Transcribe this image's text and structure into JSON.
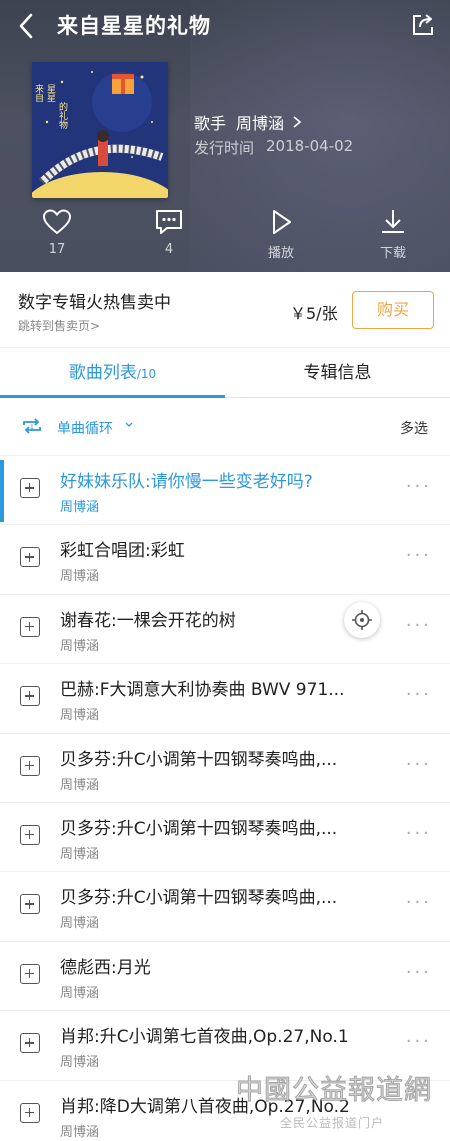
{
  "header": {
    "title": "来自星星的礼物"
  },
  "album": {
    "artist_label": "歌手",
    "artist_name": "周博涵",
    "release_label": "发行时间",
    "release_date": "2018-04-02",
    "cover_text": "来自星星的礼物"
  },
  "actions": {
    "like_count": "17",
    "comment_count": "4",
    "play_label": "播放",
    "download_label": "下载"
  },
  "sale": {
    "title": "数字专辑火热售卖中",
    "link": "跳转到售卖页>",
    "price": "￥5/张",
    "buy_label": "购买"
  },
  "tabs": {
    "songs_label": "歌曲列表",
    "songs_count": "/10",
    "info_label": "专辑信息"
  },
  "mode": {
    "label": "单曲循环",
    "multi_select": "多选"
  },
  "songs": [
    {
      "title": "好妹妹乐队:请你慢一些变老好吗?",
      "artist": "周博涵"
    },
    {
      "title": "彩虹合唱团:彩虹",
      "artist": "周博涵"
    },
    {
      "title": "谢春花:一棵会开花的树",
      "artist": "周博涵"
    },
    {
      "title": "巴赫:F大调意大利协奏曲 BWV 971...",
      "artist": "周博涵"
    },
    {
      "title": "贝多芬:升C小调第十四钢琴奏鸣曲,...",
      "artist": "周博涵"
    },
    {
      "title": "贝多芬:升C小调第十四钢琴奏鸣曲,...",
      "artist": "周博涵"
    },
    {
      "title": "贝多芬:升C小调第十四钢琴奏鸣曲,...",
      "artist": "周博涵"
    },
    {
      "title": "德彪西:月光",
      "artist": "周博涵"
    },
    {
      "title": "肖邦:升C小调第七首夜曲,Op.27,No.1",
      "artist": "周博涵"
    },
    {
      "title": "肖邦:降D大调第八首夜曲,Op.27,No.2",
      "artist": "周博涵"
    }
  ],
  "more_glyph": "···",
  "watermark": {
    "main": "中國公益報道網",
    "sub": "全民公益报道门户"
  },
  "colors": {
    "accent": "#2b98e0",
    "buy": "#f0a445",
    "hero_bg": "#4a4f60"
  },
  "icons": [
    "back-icon",
    "share-icon",
    "heart-icon",
    "comment-icon",
    "play-icon",
    "download-icon",
    "repeat-one-icon",
    "chevron-down-icon",
    "add-icon",
    "more-icon",
    "locate-icon"
  ]
}
